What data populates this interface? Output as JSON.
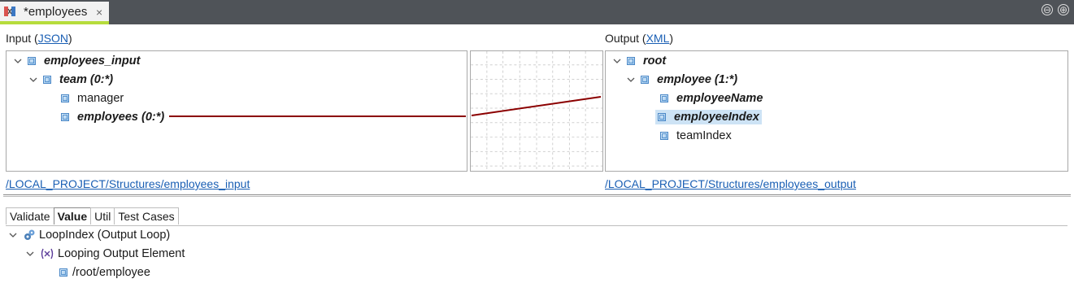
{
  "tab": {
    "title": "*employees",
    "close": "×"
  },
  "window_buttons": {
    "minimize": "⊖",
    "maximize": "⊕"
  },
  "input": {
    "label_prefix": "Input (",
    "format": "JSON",
    "label_suffix": ")",
    "tree": [
      {
        "label": "employees_input"
      },
      {
        "label": "team (0:*)"
      },
      {
        "label": "manager"
      },
      {
        "label": "employees (0:*)"
      }
    ],
    "path": "/LOCAL_PROJECT/Structures/employees_input"
  },
  "output": {
    "label_prefix": "Output (",
    "format": "XML",
    "label_suffix": ")",
    "tree": [
      {
        "label": "root"
      },
      {
        "label": "employee (1:*)"
      },
      {
        "label": "employeeName"
      },
      {
        "label": "employeeIndex"
      },
      {
        "label": "teamIndex"
      }
    ],
    "path": "/LOCAL_PROJECT/Structures/employees_output"
  },
  "colors": {
    "mapping_line": "#8b0000",
    "tab_accent": "#b6dc3c",
    "selection": "#cde3f5"
  },
  "bottom_tabs": [
    "Validate",
    "Value",
    "Util",
    "Test Cases"
  ],
  "active_bottom_tab": "Value",
  "properties_tree": [
    {
      "label": "LoopIndex (Output Loop)",
      "icon": "gears-icon"
    },
    {
      "label": "Looping Output Element",
      "icon": "variable-icon"
    },
    {
      "label": "/root/employee",
      "icon": "element-link-icon"
    }
  ]
}
